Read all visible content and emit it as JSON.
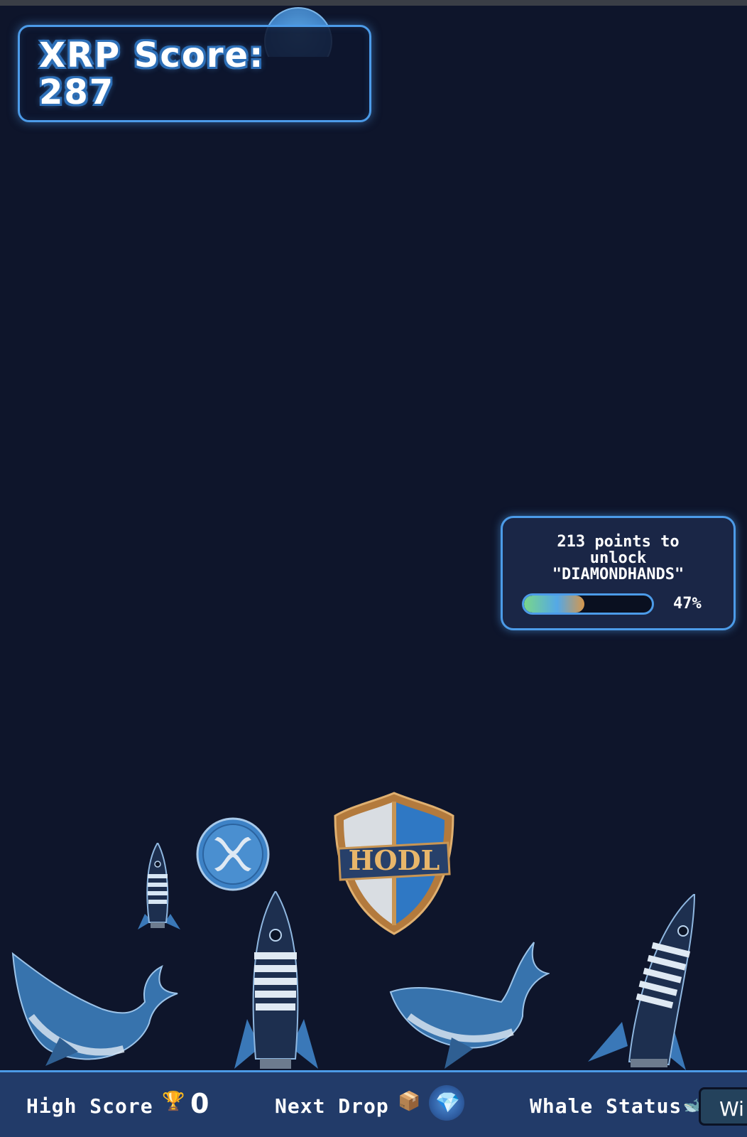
{
  "score_panel": {
    "label": "XRP Score:",
    "value": "287"
  },
  "unlock_panel": {
    "line1": "213 points to",
    "line2": "unlock",
    "line3": "\"DIAMONDHANDS\"",
    "progress_percent": 47,
    "progress_label": "47%"
  },
  "sprites": {
    "shield_text": "HODL"
  },
  "bottom_bar": {
    "high_score_label": "High Score",
    "high_score_icon": "trophy-icon",
    "high_score_value": "0",
    "next_drop_label": "Next Drop",
    "next_drop_icon": "package-icon",
    "next_drop_item_icon": "gem-icon",
    "whale_status_label": "Whale Status",
    "whale_status_value": "Wi"
  },
  "colors": {
    "background": "#0e152b",
    "accent": "#4c9be8",
    "bar": "#223b69"
  }
}
